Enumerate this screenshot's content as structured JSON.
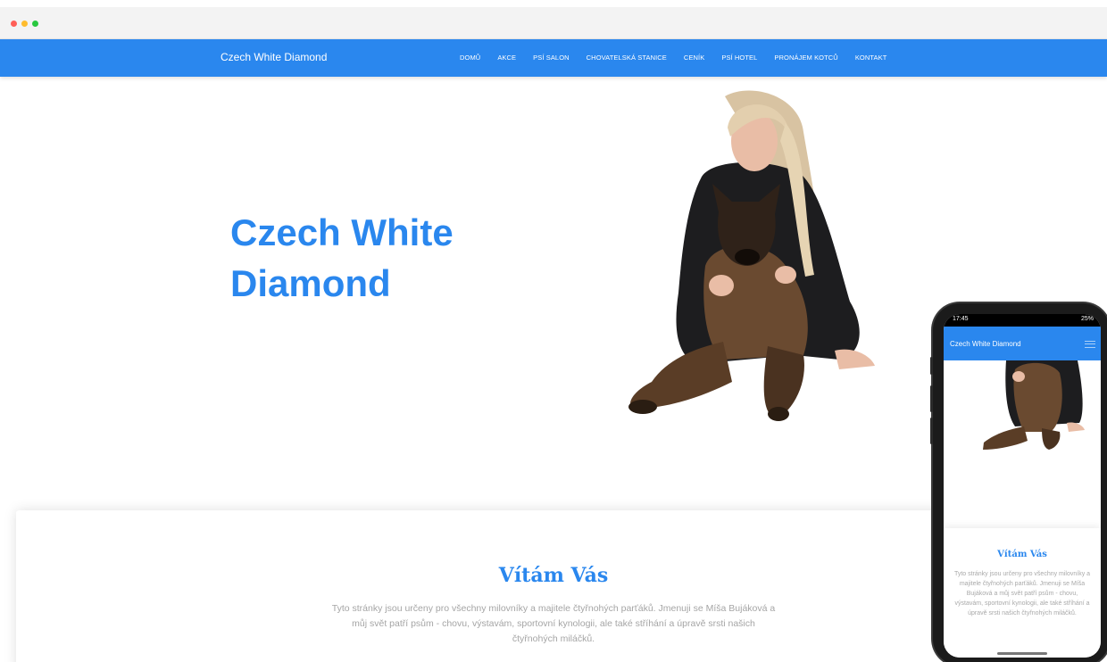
{
  "navbar": {
    "brand": "Czech White Diamond",
    "items": [
      "DOMŮ",
      "AKCE",
      "PSÍ SALON",
      "CHOVATELSKÁ STANICE",
      "CENÍK",
      "PSÍ HOTEL",
      "PRONÁJEM KOTCŮ",
      "KONTAKT"
    ]
  },
  "hero": {
    "title": "Czech White Diamond"
  },
  "welcome": {
    "title": "Vítám Vás",
    "text": "Tyto stránky jsou určeny pro všechny milovníky a majitele čtyřnohých parťáků. Jmenuji se Míša Bujáková a můj svět patří psům - chovu, výstavám, sportovní kynologii, ale také stříhání a úpravě srsti našich čtyřnohých miláčků."
  },
  "phone": {
    "time": "17:45",
    "battery": "25%",
    "brand": "Czech White Diamond",
    "welcome_title": "Vítám Vás",
    "welcome_text": "Tyto stránky jsou určeny pro všechny milovníky a majitele čtyřnohých parťáků. Jmenuji se Míša Bujáková a můj svět patří psům - chovu, výstavám, sportovní kynologii, ale také stříhání a úpravě srsti našich čtyřnohých miláčků."
  },
  "colors": {
    "accent": "#2a87ee",
    "text_muted": "#a5a5a5"
  }
}
